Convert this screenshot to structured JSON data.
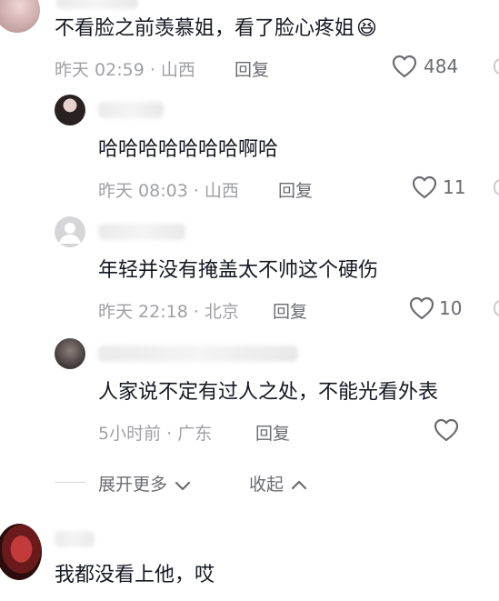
{
  "comments": [
    {
      "text": "不看脸之前羡慕姐，看了脸心疼姐",
      "emoji": "😆",
      "meta": "昨天 02:59 · 山西",
      "reply_label": "回复",
      "likes": "484"
    }
  ],
  "replies": [
    {
      "text": "哈哈哈哈哈哈哈啊哈",
      "meta": "昨天 08:03 · 山西",
      "reply_label": "回复",
      "likes": "11"
    },
    {
      "text": "年轻并没有掩盖太不帅这个硬伤",
      "meta": "昨天 22:18 · 北京",
      "reply_label": "回复",
      "likes": "10"
    },
    {
      "text": "人家说不定有过人之处，不能光看外表",
      "meta": "5小时前 · 广东",
      "reply_label": "回复",
      "likes": ""
    }
  ],
  "thread_controls": {
    "expand_label": "展开更多",
    "collapse_label": "收起"
  },
  "bottom_comment": {
    "text": "我都没看上他，哎"
  },
  "colors": {
    "text": "#161823",
    "meta": "#9fa0a6",
    "action": "#6b6c72"
  }
}
